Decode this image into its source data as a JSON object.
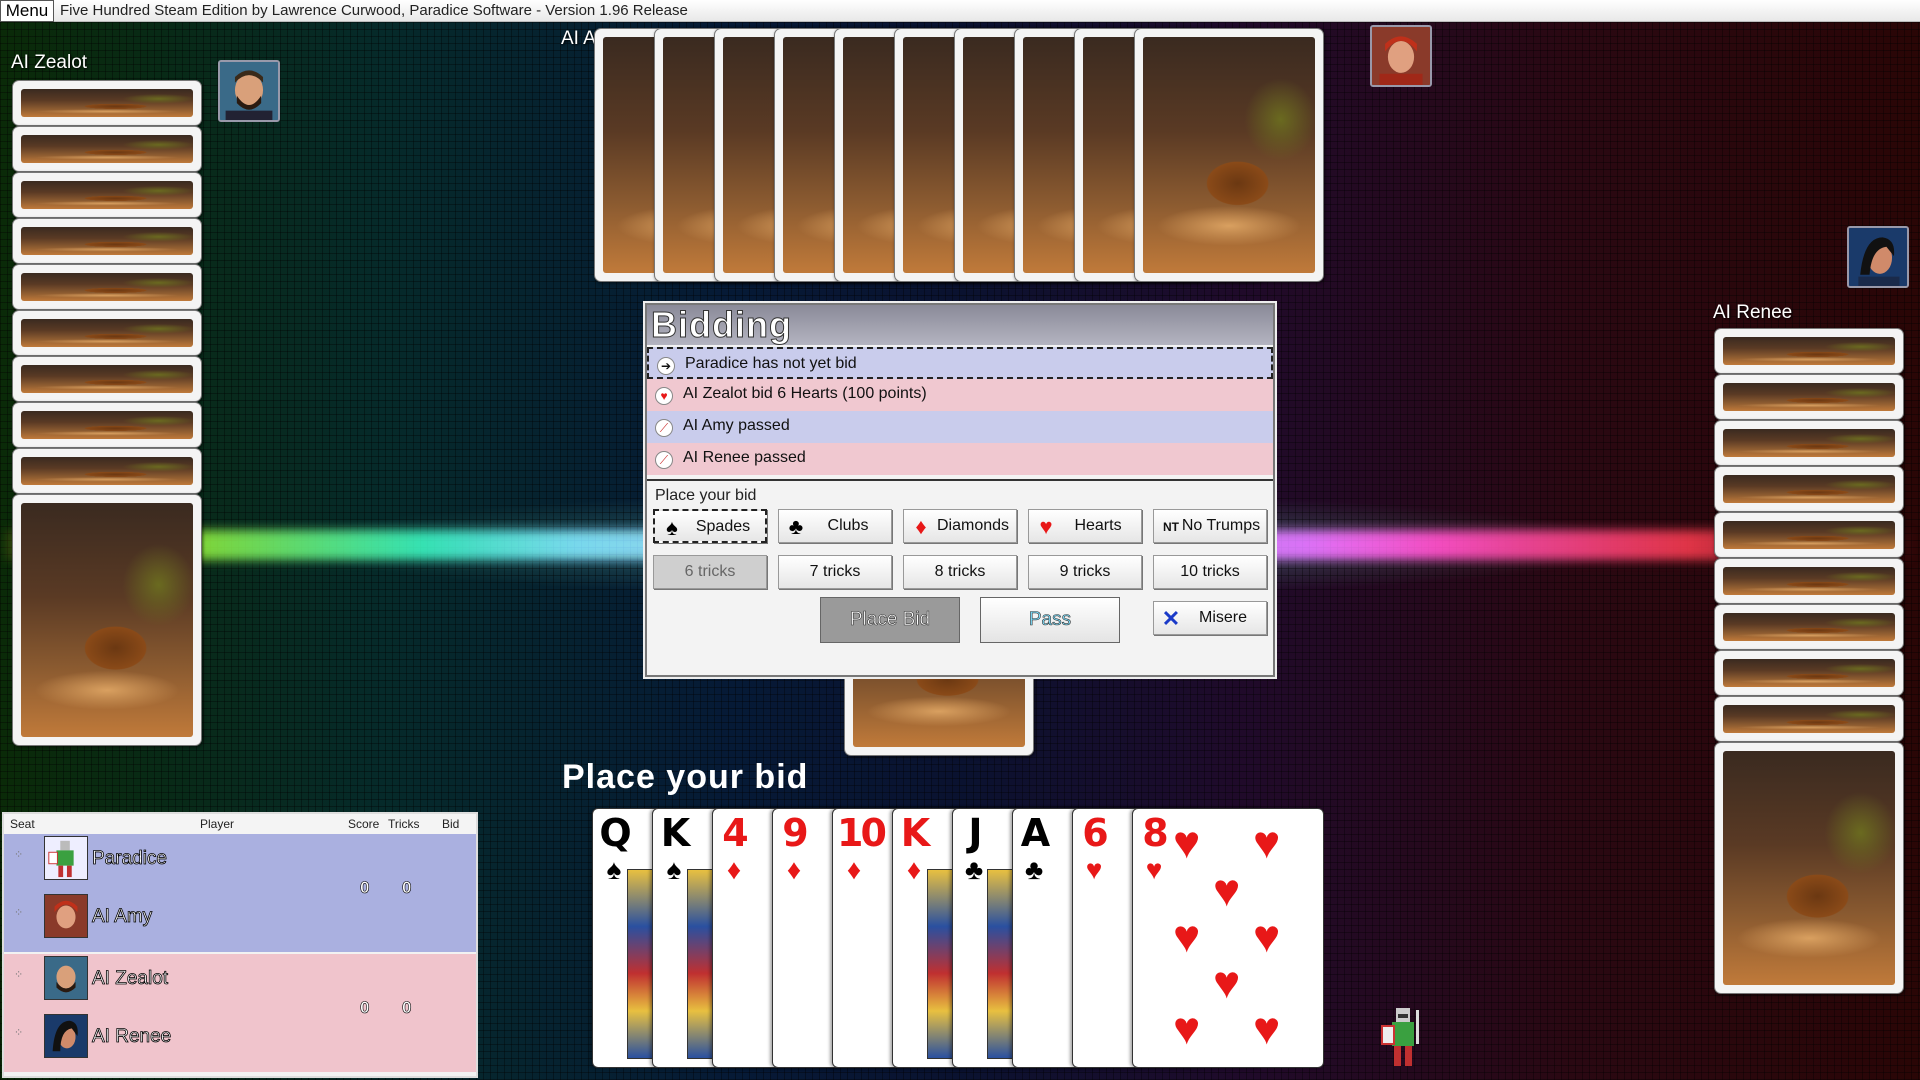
{
  "window": {
    "menu_label": "Menu",
    "title": "Five Hundred Steam Edition by Lawrence Curwood, Paradice Software - Version 1.96 Release"
  },
  "players": {
    "left": "AI Zealot",
    "top": "AI Amy",
    "right": "AI Renee"
  },
  "bidding": {
    "title": "Bidding",
    "log": [
      {
        "text": "Paradice has not yet bid",
        "icon": "arrow-right-icon",
        "style": "blue",
        "current": true
      },
      {
        "text": "AI Zealot bid 6 Hearts (100 points)",
        "icon": "heart-icon",
        "style": "pink",
        "current": false
      },
      {
        "text": "AI Amy passed",
        "icon": "pass-icon",
        "style": "blue",
        "current": false
      },
      {
        "text": "AI Renee passed",
        "icon": "pass-icon",
        "style": "pink",
        "current": false
      }
    ],
    "prompt": "Place your bid",
    "suits": {
      "spades": "Spades",
      "clubs": "Clubs",
      "diamonds": "Diamonds",
      "hearts": "Hearts",
      "no_trumps": "No Trumps",
      "nt_glyph": "NT"
    },
    "tricks": {
      "t6": "6 tricks",
      "t7": "7 tricks",
      "t8": "8 tricks",
      "t9": "9 tricks",
      "t10": "10 tricks"
    },
    "place_bid": "Place Bid",
    "pass": "Pass",
    "misere": "Misere"
  },
  "bottom_prompt": "Place your bid",
  "hand": [
    {
      "rank": "Q",
      "suit": "♠",
      "color": "black",
      "court": true
    },
    {
      "rank": "K",
      "suit": "♠",
      "color": "black",
      "court": true
    },
    {
      "rank": "4",
      "suit": "♦",
      "color": "red",
      "court": false
    },
    {
      "rank": "9",
      "suit": "♦",
      "color": "red",
      "court": false
    },
    {
      "rank": "10",
      "suit": "♦",
      "color": "red",
      "court": false
    },
    {
      "rank": "K",
      "suit": "♦",
      "color": "red",
      "court": true
    },
    {
      "rank": "J",
      "suit": "♣",
      "color": "black",
      "court": true
    },
    {
      "rank": "A",
      "suit": "♣",
      "color": "black",
      "court": false
    },
    {
      "rank": "6",
      "suit": "♥",
      "color": "red",
      "court": false
    },
    {
      "rank": "8",
      "suit": "♥",
      "color": "red",
      "court": false
    }
  ],
  "scoreboard": {
    "headers": {
      "seat": "Seat",
      "player": "Player",
      "score": "Score",
      "tricks": "Tricks",
      "bid": "Bid"
    },
    "team1": {
      "p1": "Paradice",
      "p2": "AI Amy",
      "score": "0",
      "tricks": "0"
    },
    "team2": {
      "p1": "AI Zealot",
      "p2": "AI Renee",
      "score": "0",
      "tricks": "0"
    }
  },
  "colors": {
    "red_suit": "#e81818",
    "team1_bg": "#aab0e0",
    "team2_bg": "#f0c4cc"
  }
}
